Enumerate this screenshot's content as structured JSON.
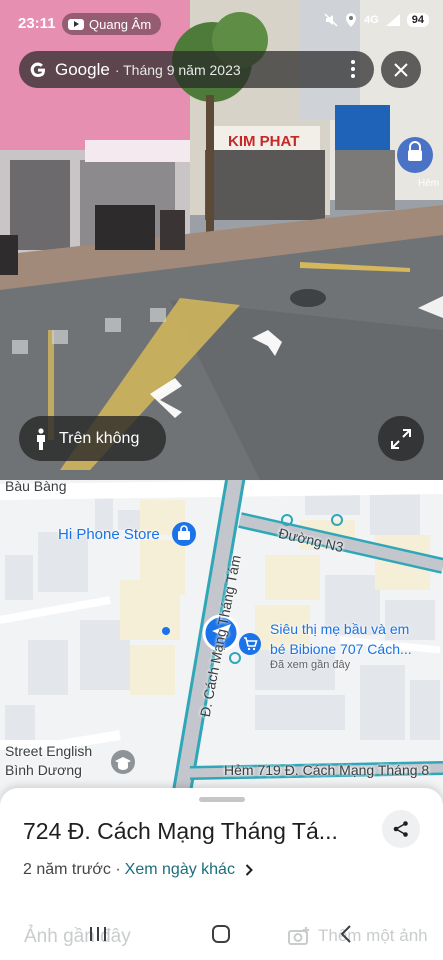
{
  "status_bar": {
    "time": "23:11",
    "youtube_label": "Quang Âm",
    "network": "4G",
    "battery": "94"
  },
  "street_view": {
    "brand": "Google",
    "capture_date": "· Tháng 9 năm 2023",
    "aerial_button_label": "Trên không",
    "nav_pin_label": "Hẻm"
  },
  "map": {
    "labels": {
      "bau_bang": "Bàu Bàng",
      "hi_phone": "Hi Phone Store",
      "duong_n3": "Đường N3",
      "cmt8_vertical": "Đ. Cách Mạng Tháng Tám",
      "sieu_thi_line1": "Siêu thị mẹ bầu và em",
      "sieu_thi_line2": "bé Bibione 707 Cách...",
      "sieu_thi_seen": "Đã xem gần đây",
      "street_english_line1": "Street English",
      "street_english_line2": "Bình Dương",
      "hem_719": "Hẻm 719 Đ. Cách Mạng Tháng 8"
    }
  },
  "sheet": {
    "title": "724 Đ. Cách Mạng Tháng Tá...",
    "time_ago": "2 năm trước ·",
    "other_dates_link": "Xem ngày khác",
    "ghost_left": "Ảnh gần đây",
    "ghost_right": "Thêm một ảnh"
  },
  "colors": {
    "accent_blue": "#1a73e8",
    "link_teal": "#1b6e7c",
    "road_outline": "#2fa7b8",
    "pill_bg": "#282828"
  },
  "icons": {
    "close": "close-icon",
    "more": "more-vert-icon",
    "aerial": "person-icon",
    "expand": "expand-icon",
    "share": "share-icon"
  }
}
